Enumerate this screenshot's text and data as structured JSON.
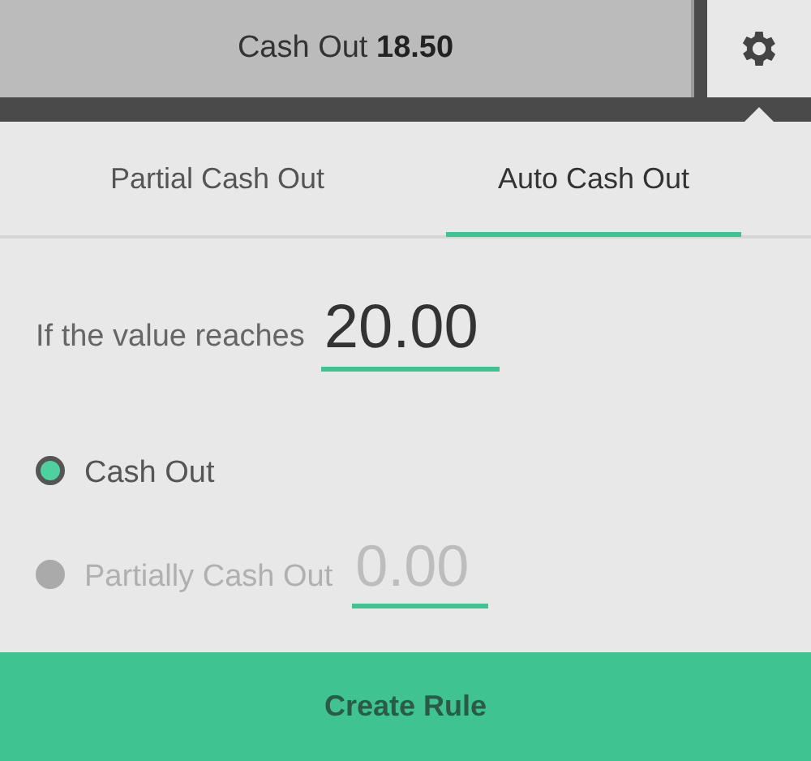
{
  "cash_out_button": {
    "label": "Cash Out **18.50**"
  },
  "tabs": [
    {
      "label": "Partial Cash Out",
      "selected": false
    },
    {
      "label": "Auto Cash Out",
      "selected": true
    }
  ],
  "rule": {
    "label": "If the value reaches",
    "value": "20.00"
  },
  "options": [
    {
      "label": "Cash Out",
      "selected": true,
      "disabled": false
    },
    {
      "label": "Partially Cash Out",
      "selected": false,
      "disabled": true,
      "value": "0.00"
    }
  ],
  "create_button": {
    "label": "Create Rule"
  }
}
